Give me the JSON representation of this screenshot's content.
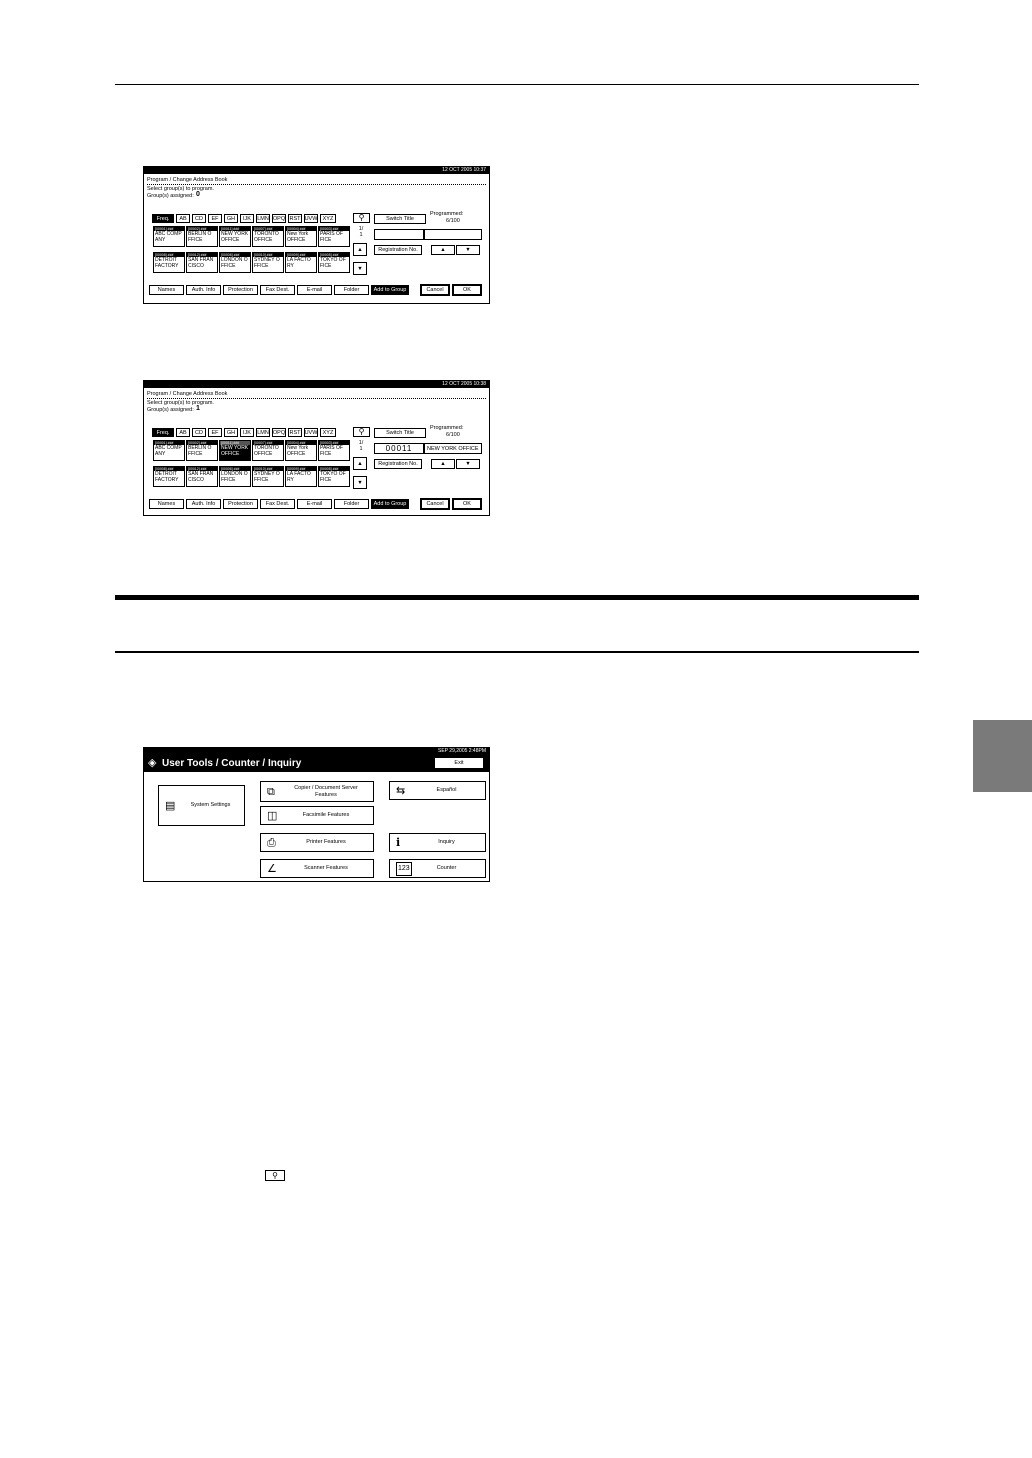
{
  "panels": [
    {
      "status": "12 OCT  2005 10:37",
      "title": "Program / Change Address Book",
      "instruction": "Select group(s) to program.",
      "assigned_label": "Group(s) assigned:",
      "assigned_value": "0",
      "tabs": [
        "Freq.",
        "AB",
        "CD",
        "EF",
        "GH",
        "IJK",
        "LMN",
        "OPQ",
        "RST",
        "UVW",
        "XYZ"
      ],
      "switch_title": "Switch Title",
      "programmed_label": "Programmed:",
      "programmed_value": "6/100",
      "page_indicator": "1/\n1",
      "field_number": "",
      "field_name": "",
      "registration": "Registration No.",
      "cells": [
        {
          "head": "[00001] ###",
          "lines": [
            "ABC COMP",
            "ANY"
          ],
          "selected": false
        },
        {
          "head": "[00002] ###",
          "lines": [
            "BERLIN O",
            "FFICE"
          ],
          "selected": false
        },
        {
          "head": "[00011] ###",
          "lines": [
            "NEW YORK",
            "OFFICE"
          ],
          "selected": false
        },
        {
          "head": "[00007] ###",
          "lines": [
            "TORONTO",
            "OFFICE"
          ],
          "selected": false
        },
        {
          "head": "[00004] ###",
          "lines": [
            "New York",
            "OFFICE"
          ],
          "selected": false
        },
        {
          "head": "[00003] ###",
          "lines": [
            "PARIS OF",
            "FICE"
          ],
          "selected": false
        },
        {
          "head": "[00008] ###",
          "lines": [
            "DETROIT",
            "FACTORY"
          ],
          "selected": false
        },
        {
          "head": "[00012] ###",
          "lines": [
            "SAN FRAN",
            "CISCO"
          ],
          "selected": false
        },
        {
          "head": "[00006] ###",
          "lines": [
            "LONDON O",
            "FFICE"
          ],
          "selected": false
        },
        {
          "head": "[00010] ###",
          "lines": [
            "SYDNEY O",
            "FFICE"
          ],
          "selected": false
        },
        {
          "head": "[00009] ###",
          "lines": [
            "LA FACTO",
            "RY"
          ],
          "selected": false
        },
        {
          "head": "[00005] ###",
          "lines": [
            "TOKYO OF",
            "FICE"
          ],
          "selected": false
        }
      ],
      "bottom_tabs": [
        "Names",
        "Auth. Info",
        "Protection",
        "Fax Dest.",
        "E-mail",
        "Folder",
        "Add to Group"
      ],
      "cancel": "Cancel",
      "ok": "OK"
    },
    {
      "status": "12 OCT  2005 10:38",
      "title": "Program / Change Address Book",
      "instruction": "Select group(s) to program.",
      "assigned_label": "Group(s) assigned:",
      "assigned_value": "1",
      "tabs": [
        "Freq.",
        "AB",
        "CD",
        "EF",
        "GH",
        "IJK",
        "LMN",
        "OPQ",
        "RST",
        "UVW",
        "XYZ"
      ],
      "switch_title": "Switch Title",
      "programmed_label": "Programmed:",
      "programmed_value": "6/100",
      "page_indicator": "1/\n1",
      "field_number": "00011",
      "field_name": "NEW YORK OFFICE",
      "registration": "Registration No.",
      "cells": [
        {
          "head": "[00001] ###",
          "lines": [
            "ABC COMP",
            "ANY"
          ],
          "selected": false
        },
        {
          "head": "[00002] ###",
          "lines": [
            "BERLIN O",
            "FFICE"
          ],
          "selected": false
        },
        {
          "head": "[00011] ###",
          "lines": [
            "NEW YORK",
            "OFFICE"
          ],
          "selected": true
        },
        {
          "head": "[00007] ###",
          "lines": [
            "TORONTO",
            "OFFICE"
          ],
          "selected": false
        },
        {
          "head": "[00004] ###",
          "lines": [
            "New York",
            "OFFICE"
          ],
          "selected": false
        },
        {
          "head": "[00003] ###",
          "lines": [
            "PARIS OF",
            "FICE"
          ],
          "selected": false
        },
        {
          "head": "[00008] ###",
          "lines": [
            "DETROIT",
            "FACTORY"
          ],
          "selected": false
        },
        {
          "head": "[00012] ###",
          "lines": [
            "SAN FRAN",
            "CISCO"
          ],
          "selected": false
        },
        {
          "head": "[00006] ###",
          "lines": [
            "LONDON O",
            "FFICE"
          ],
          "selected": false
        },
        {
          "head": "[00010] ###",
          "lines": [
            "SYDNEY O",
            "FFICE"
          ],
          "selected": false
        },
        {
          "head": "[00009] ###",
          "lines": [
            "LA FACTO",
            "RY"
          ],
          "selected": false
        },
        {
          "head": "[00005] ###",
          "lines": [
            "TOKYO OF",
            "FICE"
          ],
          "selected": false
        }
      ],
      "bottom_tabs": [
        "Names",
        "Auth. Info",
        "Protection",
        "Fax Dest.",
        "E-mail",
        "Folder",
        "Add to Group"
      ],
      "cancel": "Cancel",
      "ok": "OK"
    }
  ],
  "user_tools": {
    "status": "SEP  29,2005  2:48PM",
    "title": "User Tools / Counter / Inquiry",
    "exit": "Exit",
    "system_settings": "System Settings",
    "copier": "Copier / Document Server\nFeatures",
    "facsimile": "Facsimile Features",
    "printer": "Printer Features",
    "scanner": "Scanner Features",
    "language": "Español",
    "inquiry": "Inquiry",
    "counter": "Counter",
    "icons": {
      "title": "diamond-tools-icon",
      "system": "system-settings-icon",
      "copier": "copier-icon",
      "facsimile": "fax-icon",
      "printer": "printer-icon",
      "scanner": "scanner-icon",
      "language": "language-icon",
      "inquiry": "info-icon",
      "counter": "counter-icon"
    }
  },
  "inline_icon": "search-key-icon"
}
